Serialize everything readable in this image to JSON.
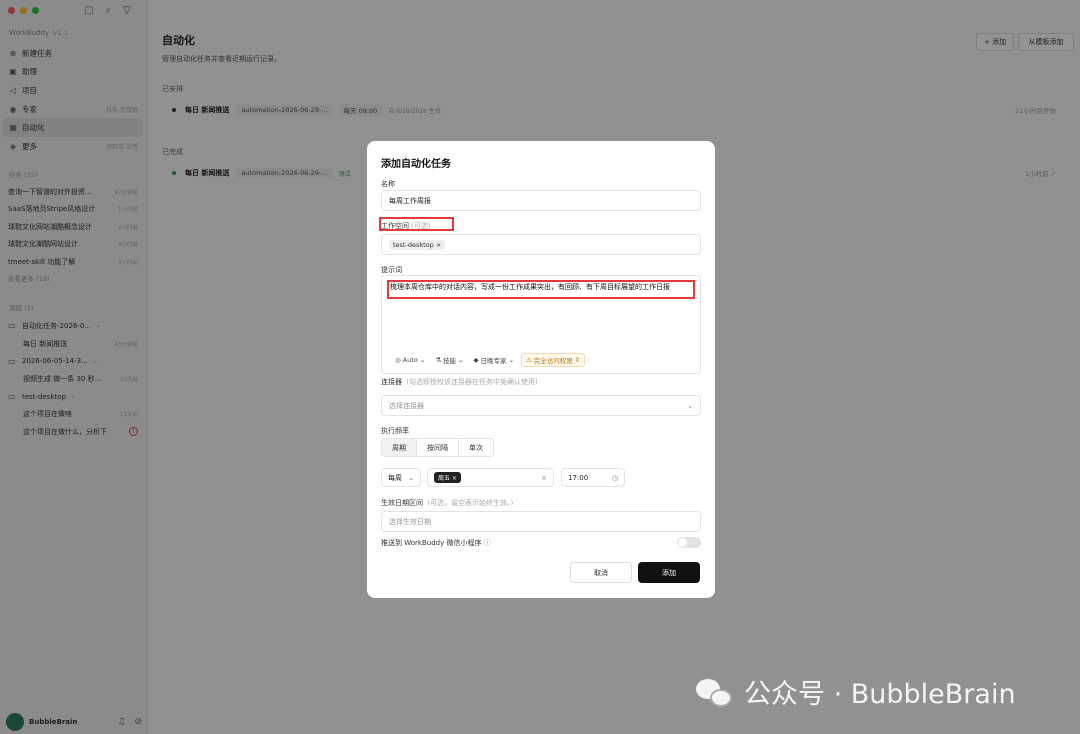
{
  "sidebar": {
    "traffic_colors": [
      "#ff5f57",
      "#febc2e",
      "#28c840"
    ],
    "brand": "WorkBuddy",
    "version": "v1.1",
    "nav": [
      {
        "icon": "plus-circle-icon",
        "glyph": "⊕",
        "label": "新建任务",
        "meta": ""
      },
      {
        "icon": "assistant-icon",
        "glyph": "▣",
        "label": "助理",
        "meta": ""
      },
      {
        "icon": "project-icon",
        "glyph": "◁",
        "label": "项目",
        "meta": ""
      },
      {
        "icon": "expert-icon",
        "glyph": "◉",
        "label": "专家",
        "meta": "技能·连接器"
      },
      {
        "icon": "automation-icon",
        "glyph": "▦",
        "label": "自动化",
        "meta": ""
      },
      {
        "icon": "more-icon",
        "glyph": "◈",
        "label": "更多",
        "meta": "资料库·灵感"
      }
    ],
    "tasks_title": "任务 (35)",
    "tasks": [
      {
        "title": "查询一下智谱的对外投资...",
        "time": "47分钟前"
      },
      {
        "title": "SaaS落地页Stripe风格设计",
        "time": "1小时前"
      },
      {
        "title": "球鞋文化网站潮酷概念设计",
        "time": "2小时前"
      },
      {
        "title": "球鞋文化潮酷网站设计",
        "time": "3小时前"
      },
      {
        "title": "tmeet-skill 功能了解",
        "time": "3小时前"
      }
    ],
    "see_more": "查看更多 (19)",
    "projects_title": "项目 (3)",
    "projects": [
      {
        "type": "folder",
        "title": "自动化任务-2026-0...",
        "time": "",
        "warn": false
      },
      {
        "type": "item",
        "title": "每日 新闻推送",
        "time": "43分钟前",
        "warn": false
      },
      {
        "type": "folder",
        "title": "2026-06-05-14-3...",
        "time": "",
        "warn": false
      },
      {
        "type": "item",
        "title": "视频生成 做一条 30 秒...",
        "time": "23天前",
        "warn": false
      },
      {
        "type": "folder",
        "title": "test-desktop",
        "time": "",
        "warn": false
      },
      {
        "type": "item",
        "title": "这个项目在做啥",
        "time": "11天前",
        "warn": false
      },
      {
        "type": "item",
        "title": "这个项目在做什么，分析下",
        "time": "",
        "warn": true
      }
    ],
    "user_name": "BubbleBrain"
  },
  "main": {
    "title": "自动化",
    "desc": "管理自动化任务并查看近期运行记录。",
    "add_btn": "+ 添加",
    "template_btn": "从模板添加",
    "scheduled_label": "已安排",
    "scheduled": {
      "name": "每日 新闻推送",
      "chip": "automation-2026-06-29-...",
      "freq": "每天 09:00",
      "extra": "自 6/28/2026 生效",
      "right": "21小时后开始",
      "dot": "#333333"
    },
    "completed_label": "已完成",
    "completed": {
      "name": "每日 新闻推送",
      "chip": "automation-2026-06-29-...",
      "extra": "测试",
      "right": "1小时前 ✓",
      "dot": "#2e9a57"
    }
  },
  "modal": {
    "title": "添加自动化任务",
    "name_label": "名称",
    "name_value": "每周工作周报",
    "workspace_label": "工作空间",
    "workspace_optional": "(可选)",
    "workspace_tag": "test-desktop ×",
    "prompt_label": "提示词",
    "prompt_value": "梳理本周仓库中的对话内容，写成一份工作成果突出，有回顾、有下周目标展望的工作日报",
    "tools": {
      "auto": "Auto",
      "skill": "技能",
      "expert": "日晚专家",
      "permission": "完全访问权限"
    },
    "connector_label": "连接器",
    "connector_hint": "(勾选即授权该连接器在任务中免确认使用)",
    "connector_placeholder": "选择连接器",
    "freq_label": "执行频率",
    "freq_tabs": [
      "周期",
      "按间隔",
      "单次"
    ],
    "period_select": "每周",
    "weekday_tag": "周五 ×",
    "time_value": "17:00",
    "date_label": "生效日期区间",
    "date_hint": "(可选，留空表示始终生效。)",
    "date_placeholder": "选择生效日期",
    "push_label": "推送到 WorkBuddy 微信小程序",
    "cancel": "取消",
    "submit": "添加"
  },
  "watermark": "公众号 · BubbleBrain",
  "colors": {
    "accent": "#111111",
    "highlight": "#e23a3a",
    "warning": "#b97a14"
  }
}
